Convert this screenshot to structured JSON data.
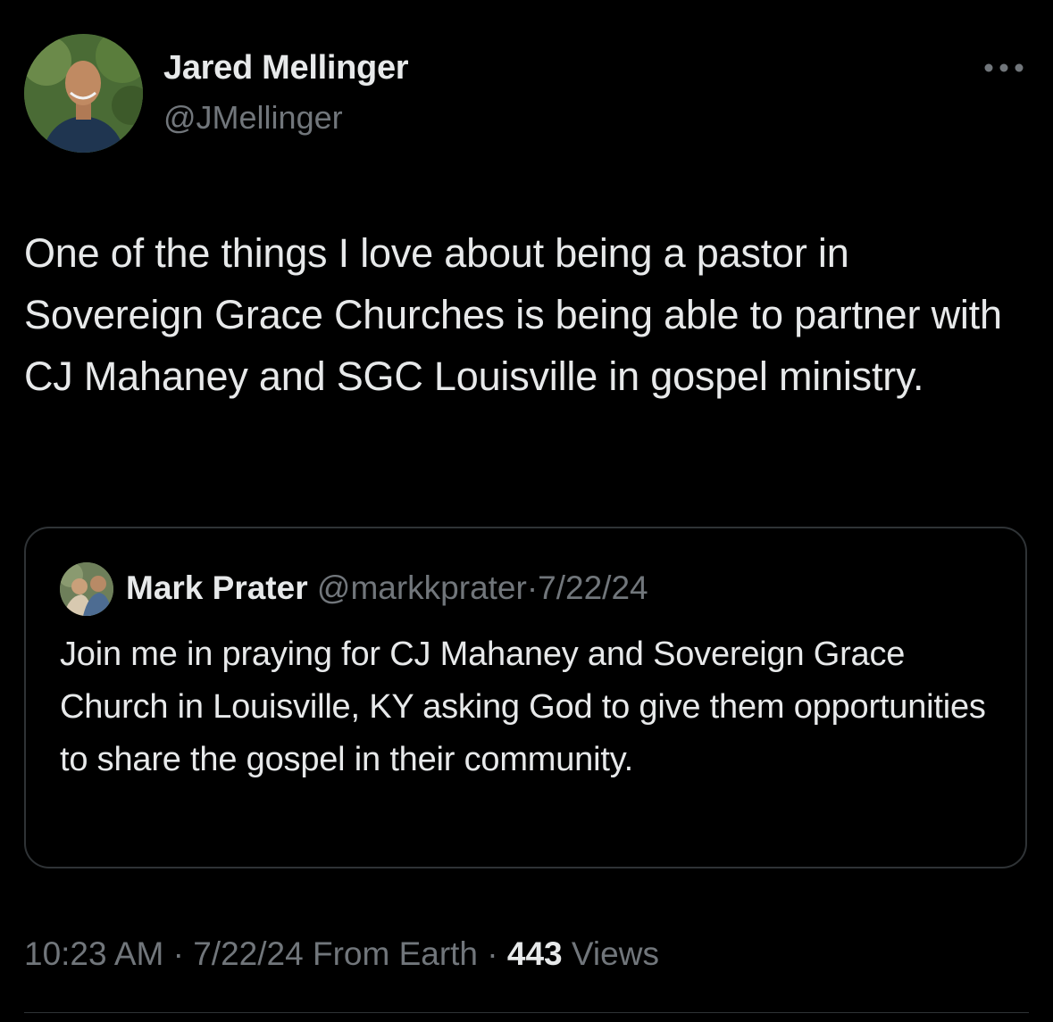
{
  "tweet": {
    "author": {
      "name": "Jared Mellinger",
      "handle": "@JMellinger"
    },
    "more_icon": "more-horizontal-icon",
    "text": "One of the things I love about being a pastor in Sovereign Grace Churches is being able to partner with CJ Mahaney and SGC Louisville in gospel ministry.",
    "quoted": {
      "name": "Mark Prater",
      "handle": "@markkprater",
      "separator": "·",
      "date": "7/22/24",
      "text": "Join me in praying for CJ Mahaney and Sovereign Grace Church in Louisville, KY asking God to give them opportunities to share the gospel in their community."
    },
    "meta": {
      "time": "10:23 AM",
      "sep1": "·",
      "date": "7/22/24",
      "source": "From Earth",
      "sep2": "·",
      "views_count": "443",
      "views_label": "Views"
    }
  },
  "colors": {
    "background": "#000000",
    "primary_text": "#e7e9ea",
    "secondary_text": "#71767b",
    "border": "#2f3336"
  }
}
